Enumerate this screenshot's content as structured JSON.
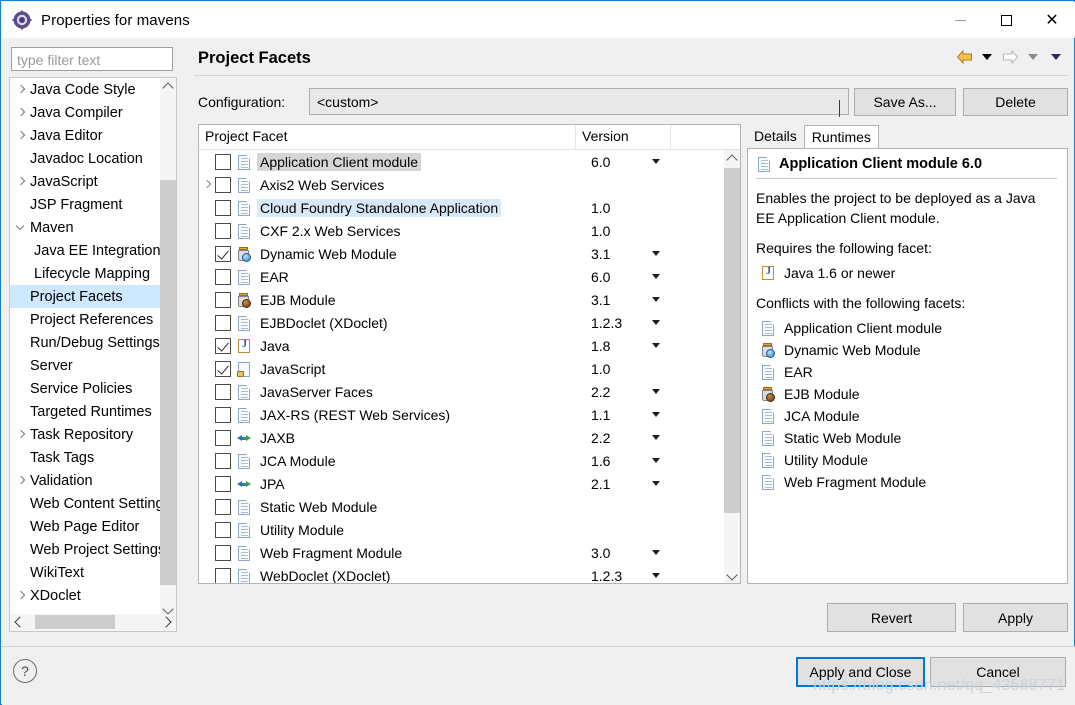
{
  "window": {
    "title": "Properties for mavens",
    "icon": "eclipse-properties-icon",
    "minimize": "minimize-icon",
    "maximize": "maximize-icon",
    "close": "close-icon"
  },
  "sidebar": {
    "filter_placeholder": "type filter text",
    "filter_value": "",
    "items": [
      {
        "label": "Java Code Style",
        "expandable": true,
        "expanded": false,
        "child": false,
        "selected": false
      },
      {
        "label": "Java Compiler",
        "expandable": true,
        "expanded": false,
        "child": false,
        "selected": false
      },
      {
        "label": "Java Editor",
        "expandable": true,
        "expanded": false,
        "child": false,
        "selected": false
      },
      {
        "label": "Javadoc Location",
        "expandable": false,
        "expanded": false,
        "child": false,
        "selected": false
      },
      {
        "label": "JavaScript",
        "expandable": true,
        "expanded": false,
        "child": false,
        "selected": false
      },
      {
        "label": "JSP Fragment",
        "expandable": false,
        "expanded": false,
        "child": false,
        "selected": false
      },
      {
        "label": "Maven",
        "expandable": true,
        "expanded": true,
        "child": false,
        "selected": false
      },
      {
        "label": "Java EE Integration",
        "expandable": false,
        "expanded": false,
        "child": true,
        "selected": false
      },
      {
        "label": "Lifecycle Mapping",
        "expandable": false,
        "expanded": false,
        "child": true,
        "selected": false
      },
      {
        "label": "Project Facets",
        "expandable": false,
        "expanded": false,
        "child": false,
        "selected": true
      },
      {
        "label": "Project References",
        "expandable": false,
        "expanded": false,
        "child": false,
        "selected": false
      },
      {
        "label": "Run/Debug Settings",
        "expandable": false,
        "expanded": false,
        "child": false,
        "selected": false
      },
      {
        "label": "Server",
        "expandable": false,
        "expanded": false,
        "child": false,
        "selected": false
      },
      {
        "label": "Service Policies",
        "expandable": false,
        "expanded": false,
        "child": false,
        "selected": false
      },
      {
        "label": "Targeted Runtimes",
        "expandable": false,
        "expanded": false,
        "child": false,
        "selected": false
      },
      {
        "label": "Task Repository",
        "expandable": true,
        "expanded": false,
        "child": false,
        "selected": false
      },
      {
        "label": "Task Tags",
        "expandable": false,
        "expanded": false,
        "child": false,
        "selected": false
      },
      {
        "label": "Validation",
        "expandable": true,
        "expanded": false,
        "child": false,
        "selected": false
      },
      {
        "label": "Web Content Settings",
        "expandable": false,
        "expanded": false,
        "child": false,
        "selected": false
      },
      {
        "label": "Web Page Editor",
        "expandable": false,
        "expanded": false,
        "child": false,
        "selected": false
      },
      {
        "label": "Web Project Settings",
        "expandable": false,
        "expanded": false,
        "child": false,
        "selected": false
      },
      {
        "label": "WikiText",
        "expandable": false,
        "expanded": false,
        "child": false,
        "selected": false
      },
      {
        "label": "XDoclet",
        "expandable": true,
        "expanded": false,
        "child": false,
        "selected": false
      }
    ]
  },
  "header": {
    "page_title": "Project Facets",
    "nav_back": "back-arrow-icon",
    "nav_back_menu": "chevron-down-icon",
    "nav_forward": "forward-arrow-icon",
    "nav_forward_menu": "chevron-down-icon",
    "nav_extra_menu": "chevron-down-icon"
  },
  "configuration": {
    "label": "Configuration:",
    "value": "<custom>",
    "save_as": "Save As...",
    "delete": "Delete"
  },
  "facet_table": {
    "columns": [
      "Project Facet",
      "Version"
    ],
    "rows": [
      {
        "name": "Application Client module",
        "version": "6.0",
        "checked": false,
        "icon": "doc",
        "expandable": false,
        "highlight": "grey"
      },
      {
        "name": "Axis2 Web Services",
        "version": "",
        "checked": false,
        "icon": "doc",
        "expandable": true,
        "highlight": "none"
      },
      {
        "name": "Cloud Foundry Standalone Application",
        "version": "1.0",
        "checked": false,
        "icon": "doc",
        "expandable": false,
        "highlight": "blue"
      },
      {
        "name": "CXF 2.x Web Services",
        "version": "1.0",
        "checked": false,
        "icon": "doc",
        "expandable": false,
        "highlight": "none"
      },
      {
        "name": "Dynamic Web Module",
        "version": "3.1",
        "checked": true,
        "icon": "web",
        "expandable": false,
        "highlight": "none"
      },
      {
        "name": "EAR",
        "version": "6.0",
        "checked": false,
        "icon": "doc",
        "expandable": false,
        "highlight": "none"
      },
      {
        "name": "EJB Module",
        "version": "3.1",
        "checked": false,
        "icon": "ejb",
        "expandable": false,
        "highlight": "none"
      },
      {
        "name": "EJBDoclet (XDoclet)",
        "version": "1.2.3",
        "checked": false,
        "icon": "doc",
        "expandable": false,
        "highlight": "none"
      },
      {
        "name": "Java",
        "version": "1.8",
        "checked": true,
        "icon": "java",
        "expandable": false,
        "highlight": "none"
      },
      {
        "name": "JavaScript",
        "version": "1.0",
        "checked": true,
        "icon": "js",
        "expandable": false,
        "highlight": "none"
      },
      {
        "name": "JavaServer Faces",
        "version": "2.2",
        "checked": false,
        "icon": "doc",
        "expandable": false,
        "highlight": "none"
      },
      {
        "name": "JAX-RS (REST Web Services)",
        "version": "1.1",
        "checked": false,
        "icon": "doc",
        "expandable": false,
        "highlight": "none"
      },
      {
        "name": "JAXB",
        "version": "2.2",
        "checked": false,
        "icon": "arr",
        "expandable": false,
        "highlight": "none"
      },
      {
        "name": "JCA Module",
        "version": "1.6",
        "checked": false,
        "icon": "doc",
        "expandable": false,
        "highlight": "none"
      },
      {
        "name": "JPA",
        "version": "2.1",
        "checked": false,
        "icon": "arr",
        "expandable": false,
        "highlight": "none"
      },
      {
        "name": "Static Web Module",
        "version": "",
        "checked": false,
        "icon": "doc",
        "expandable": false,
        "highlight": "none"
      },
      {
        "name": "Utility Module",
        "version": "",
        "checked": false,
        "icon": "doc",
        "expandable": false,
        "highlight": "none"
      },
      {
        "name": "Web Fragment Module",
        "version": "3.0",
        "checked": false,
        "icon": "doc",
        "expandable": false,
        "highlight": "none"
      },
      {
        "name": "WebDoclet (XDoclet)",
        "version": "1.2.3",
        "checked": false,
        "icon": "doc",
        "expandable": false,
        "highlight": "none"
      }
    ]
  },
  "details": {
    "tabs": [
      {
        "label": "Details",
        "active": true
      },
      {
        "label": "Runtimes",
        "active": false
      }
    ],
    "heading": "Application Client module 6.0",
    "heading_icon": "doc",
    "description": "Enables the project to be deployed as a Java EE Application Client module.",
    "requires_label": "Requires the following facet:",
    "requires": [
      {
        "label": "Java 1.6 or newer",
        "icon": "java"
      }
    ],
    "conflicts_label": "Conflicts with the following facets:",
    "conflicts": [
      {
        "label": "Application Client module",
        "icon": "doc"
      },
      {
        "label": "Dynamic Web Module",
        "icon": "web"
      },
      {
        "label": "EAR",
        "icon": "doc"
      },
      {
        "label": "EJB Module",
        "icon": "ejb"
      },
      {
        "label": "JCA Module",
        "icon": "doc"
      },
      {
        "label": "Static Web Module",
        "icon": "doc"
      },
      {
        "label": "Utility Module",
        "icon": "doc"
      },
      {
        "label": "Web Fragment Module",
        "icon": "doc"
      }
    ]
  },
  "buttons": {
    "revert": "Revert",
    "apply": "Apply",
    "apply_and_close": "Apply and Close",
    "cancel": "Cancel",
    "help": "?"
  },
  "watermark": "https://blog.csdn.net/qq_43588771",
  "colors": {
    "accent": "#0078d7",
    "selection": "#cde8ff",
    "row_highlight_grey": "#d6d6d6",
    "row_highlight_blue": "#d7e9f9",
    "button_face": "#e1e1e1"
  }
}
